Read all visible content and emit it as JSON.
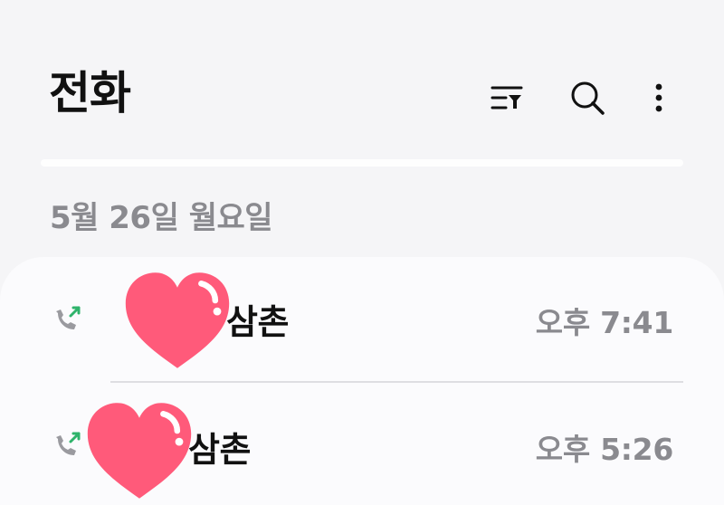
{
  "header": {
    "title": "전화",
    "icons": [
      "filter-icon",
      "search-icon",
      "more-icon"
    ]
  },
  "date_header": "5월 26일 월요일",
  "calls": [
    {
      "name": "삼촌",
      "time": "오후 7:41",
      "type": "outgoing-call",
      "icon": "outgoing-call-icon"
    },
    {
      "name": "삼촌",
      "time": "오후 5:26",
      "type": "outgoing-call",
      "icon": "outgoing-call-icon"
    }
  ],
  "colors": {
    "background": "#f5f5f7",
    "card": "#fbfbfd",
    "primary_text": "#111111",
    "secondary_text": "#8a8a8f",
    "accent_green": "#2fb36b",
    "sticker_pink": "#ff5a7a"
  }
}
